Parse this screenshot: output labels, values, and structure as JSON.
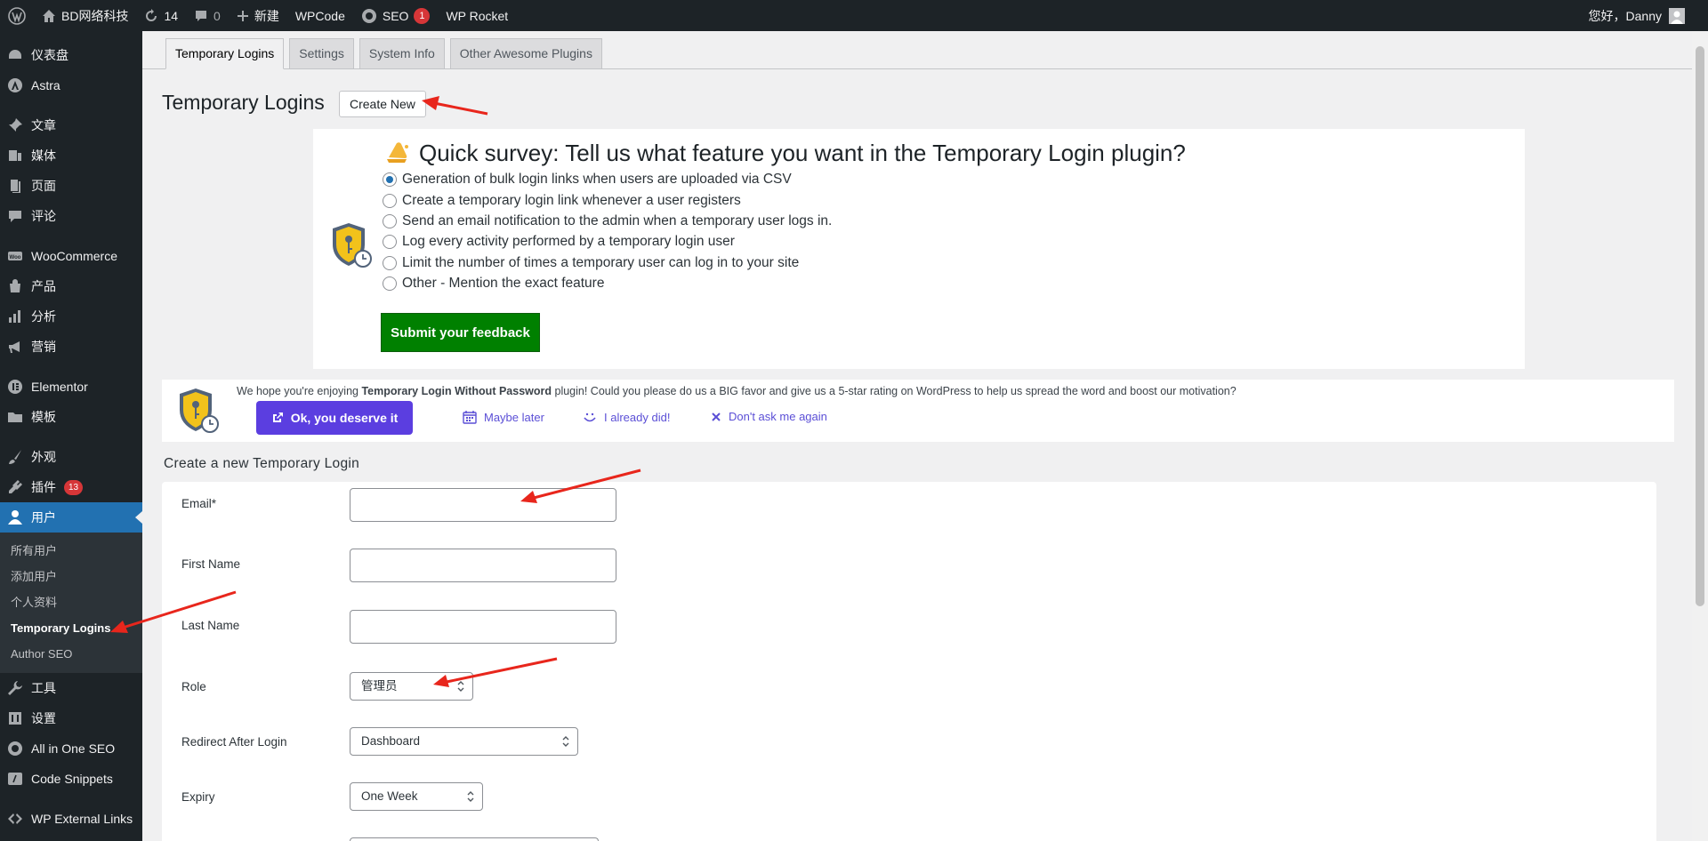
{
  "admin_bar": {
    "site_name": "BD网络科技",
    "updates_count": "14",
    "comments_count": "0",
    "new_label": "新建",
    "wpcode_label": "WPCode",
    "seo_label": "SEO",
    "seo_badge": "1",
    "wprocket_label": "WP Rocket",
    "greeting": "您好，Danny"
  },
  "sidebar": {
    "items": [
      {
        "label": "仪表盘",
        "icon": "dashboard-icon"
      },
      {
        "label": "Astra",
        "icon": "astra-icon"
      },
      {
        "label": "文章",
        "icon": "pin-icon"
      },
      {
        "label": "媒体",
        "icon": "media-icon"
      },
      {
        "label": "页面",
        "icon": "page-icon"
      },
      {
        "label": "评论",
        "icon": "comment-icon"
      },
      {
        "label": "WooCommerce",
        "icon": "woo-icon"
      },
      {
        "label": "产品",
        "icon": "product-icon"
      },
      {
        "label": "分析",
        "icon": "chart-icon"
      },
      {
        "label": "营销",
        "icon": "megaphone-icon"
      },
      {
        "label": "Elementor",
        "icon": "elementor-icon"
      },
      {
        "label": "模板",
        "icon": "folder-icon"
      },
      {
        "label": "外观",
        "icon": "brush-icon"
      },
      {
        "label": "插件",
        "icon": "plugin-icon",
        "badge": "13"
      },
      {
        "label": "用户",
        "icon": "user-icon"
      },
      {
        "label": "工具",
        "icon": "wrench-icon"
      },
      {
        "label": "设置",
        "icon": "settings-icon"
      },
      {
        "label": "All in One SEO",
        "icon": "aioseo-icon"
      },
      {
        "label": "Code Snippets",
        "icon": "code-icon"
      },
      {
        "label": "WP External Links",
        "icon": "link-icon"
      }
    ],
    "submenu": [
      "所有用户",
      "添加用户",
      "个人资料",
      "Temporary Logins",
      "Author SEO"
    ]
  },
  "tabs": [
    "Temporary Logins",
    "Settings",
    "System Info",
    "Other Awesome Plugins"
  ],
  "page": {
    "title": "Temporary Logins",
    "create_new": "Create New"
  },
  "survey": {
    "title": "Quick survey: Tell us what feature you want in the Temporary Login plugin?",
    "options": [
      "Generation of bulk login links when users are uploaded via CSV",
      "Create a temporary login link whenever a user registers",
      "Send an email notification to the admin when a temporary user logs in.",
      "Log every activity performed by a temporary login user",
      "Limit the number of times a temporary user can log in to your site",
      "Other - Mention the exact feature"
    ],
    "selected_index": 0,
    "submit_label": "Submit your feedback"
  },
  "rating_notice": {
    "msg_before": "We hope you're enjoying ",
    "plugin_name": "Temporary Login Without Password",
    "msg_after": " plugin! Could you please do us a BIG favor and give us a 5-star rating on WordPress to help us spread the word and boost our motivation?",
    "ok_label": "Ok, you deserve it",
    "later_label": "Maybe later",
    "did_label": "I already did!",
    "dont_label": "Don't ask me again"
  },
  "form": {
    "section_title": "Create a new Temporary Login",
    "email_label": "Email*",
    "first_name_label": "First Name",
    "last_name_label": "Last Name",
    "role_label": "Role",
    "role_value": "管理员",
    "redirect_label": "Redirect After Login",
    "redirect_value": "Dashboard",
    "expiry_label": "Expiry",
    "expiry_value": "One Week"
  },
  "colors": {
    "admin_dark": "#1d2327",
    "active_blue": "#2271b1",
    "submit_green": "#008000",
    "ok_purple": "#5b3ee0",
    "annotation_red": "#e8261c"
  }
}
